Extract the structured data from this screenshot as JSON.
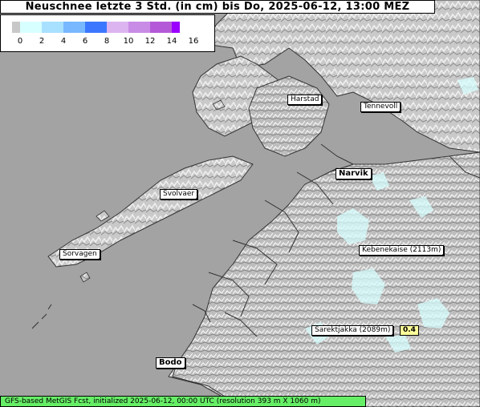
{
  "title": "Neuschnee letzte 3 Std. (in cm) bis Do, 2025-06-12, 13:00 MEZ",
  "legend": {
    "ticks": [
      "0",
      "2",
      "4",
      "6",
      "8",
      "10",
      "12",
      "14",
      "16"
    ],
    "colors": [
      "#c8c8c8",
      "#d8ffff",
      "#a8e0ff",
      "#78b8ff",
      "#3c78ff",
      "#dcb4f0",
      "#c88ce6",
      "#b45ad8",
      "#9a00ff"
    ]
  },
  "places": [
    {
      "name": "Harstad"
    },
    {
      "name": "Tennevoll"
    },
    {
      "name": "Narvik"
    },
    {
      "name": "Svolvaer"
    },
    {
      "name": "Sorvagen"
    },
    {
      "name": "Kebenekaise (2113m)"
    },
    {
      "name": "Sarektjakka (2089m)"
    },
    {
      "name": "Bodo"
    }
  ],
  "value_label": "0.4",
  "footer": "GFS-based MetGIS Fcst, initialized 2025-06-12, 00:00 UTC  (resolution 393 m X 1060 m)"
}
